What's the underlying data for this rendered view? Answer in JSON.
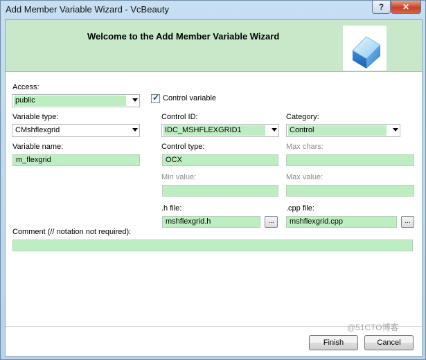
{
  "window": {
    "title": "Add Member Variable Wizard - VcBeauty",
    "help_label": "?",
    "close_label": "✕"
  },
  "banner": {
    "title": "Welcome to the Add Member Variable Wizard",
    "logo_icon": "wizard-cube-icon"
  },
  "form": {
    "access": {
      "label": "Access:",
      "value": "public"
    },
    "control_variable": {
      "label": "Control variable",
      "checked": true
    },
    "variable_type": {
      "label": "Variable type:",
      "value": "CMshflexgrid"
    },
    "control_id": {
      "label": "Control ID:",
      "value": "IDC_MSHFLEXGRID1"
    },
    "category": {
      "label": "Category:",
      "value": "Control"
    },
    "variable_name": {
      "label": "Variable name:",
      "value": "m_flexgrid"
    },
    "control_type": {
      "label": "Control type:",
      "value": "OCX"
    },
    "max_chars": {
      "label": "Max chars:",
      "value": ""
    },
    "min_value": {
      "label": "Min value:",
      "value": ""
    },
    "max_value": {
      "label": "Max value:",
      "value": ""
    },
    "h_file": {
      "label": ".h file:",
      "value": "mshflexgrid.h",
      "browse_label": "..."
    },
    "cpp_file": {
      "label": ".cpp file:",
      "value": "mshflexgrid.cpp",
      "browse_label": "..."
    },
    "comment": {
      "label": "Comment (// notation not required):",
      "value": ""
    }
  },
  "buttons": {
    "finish": "Finish",
    "cancel": "Cancel"
  },
  "watermark": "@51CTO博客",
  "colors": {
    "field_bg": "#bdeec1",
    "banner_bg": "#c8e8c9",
    "close_red": "#c4412a"
  }
}
